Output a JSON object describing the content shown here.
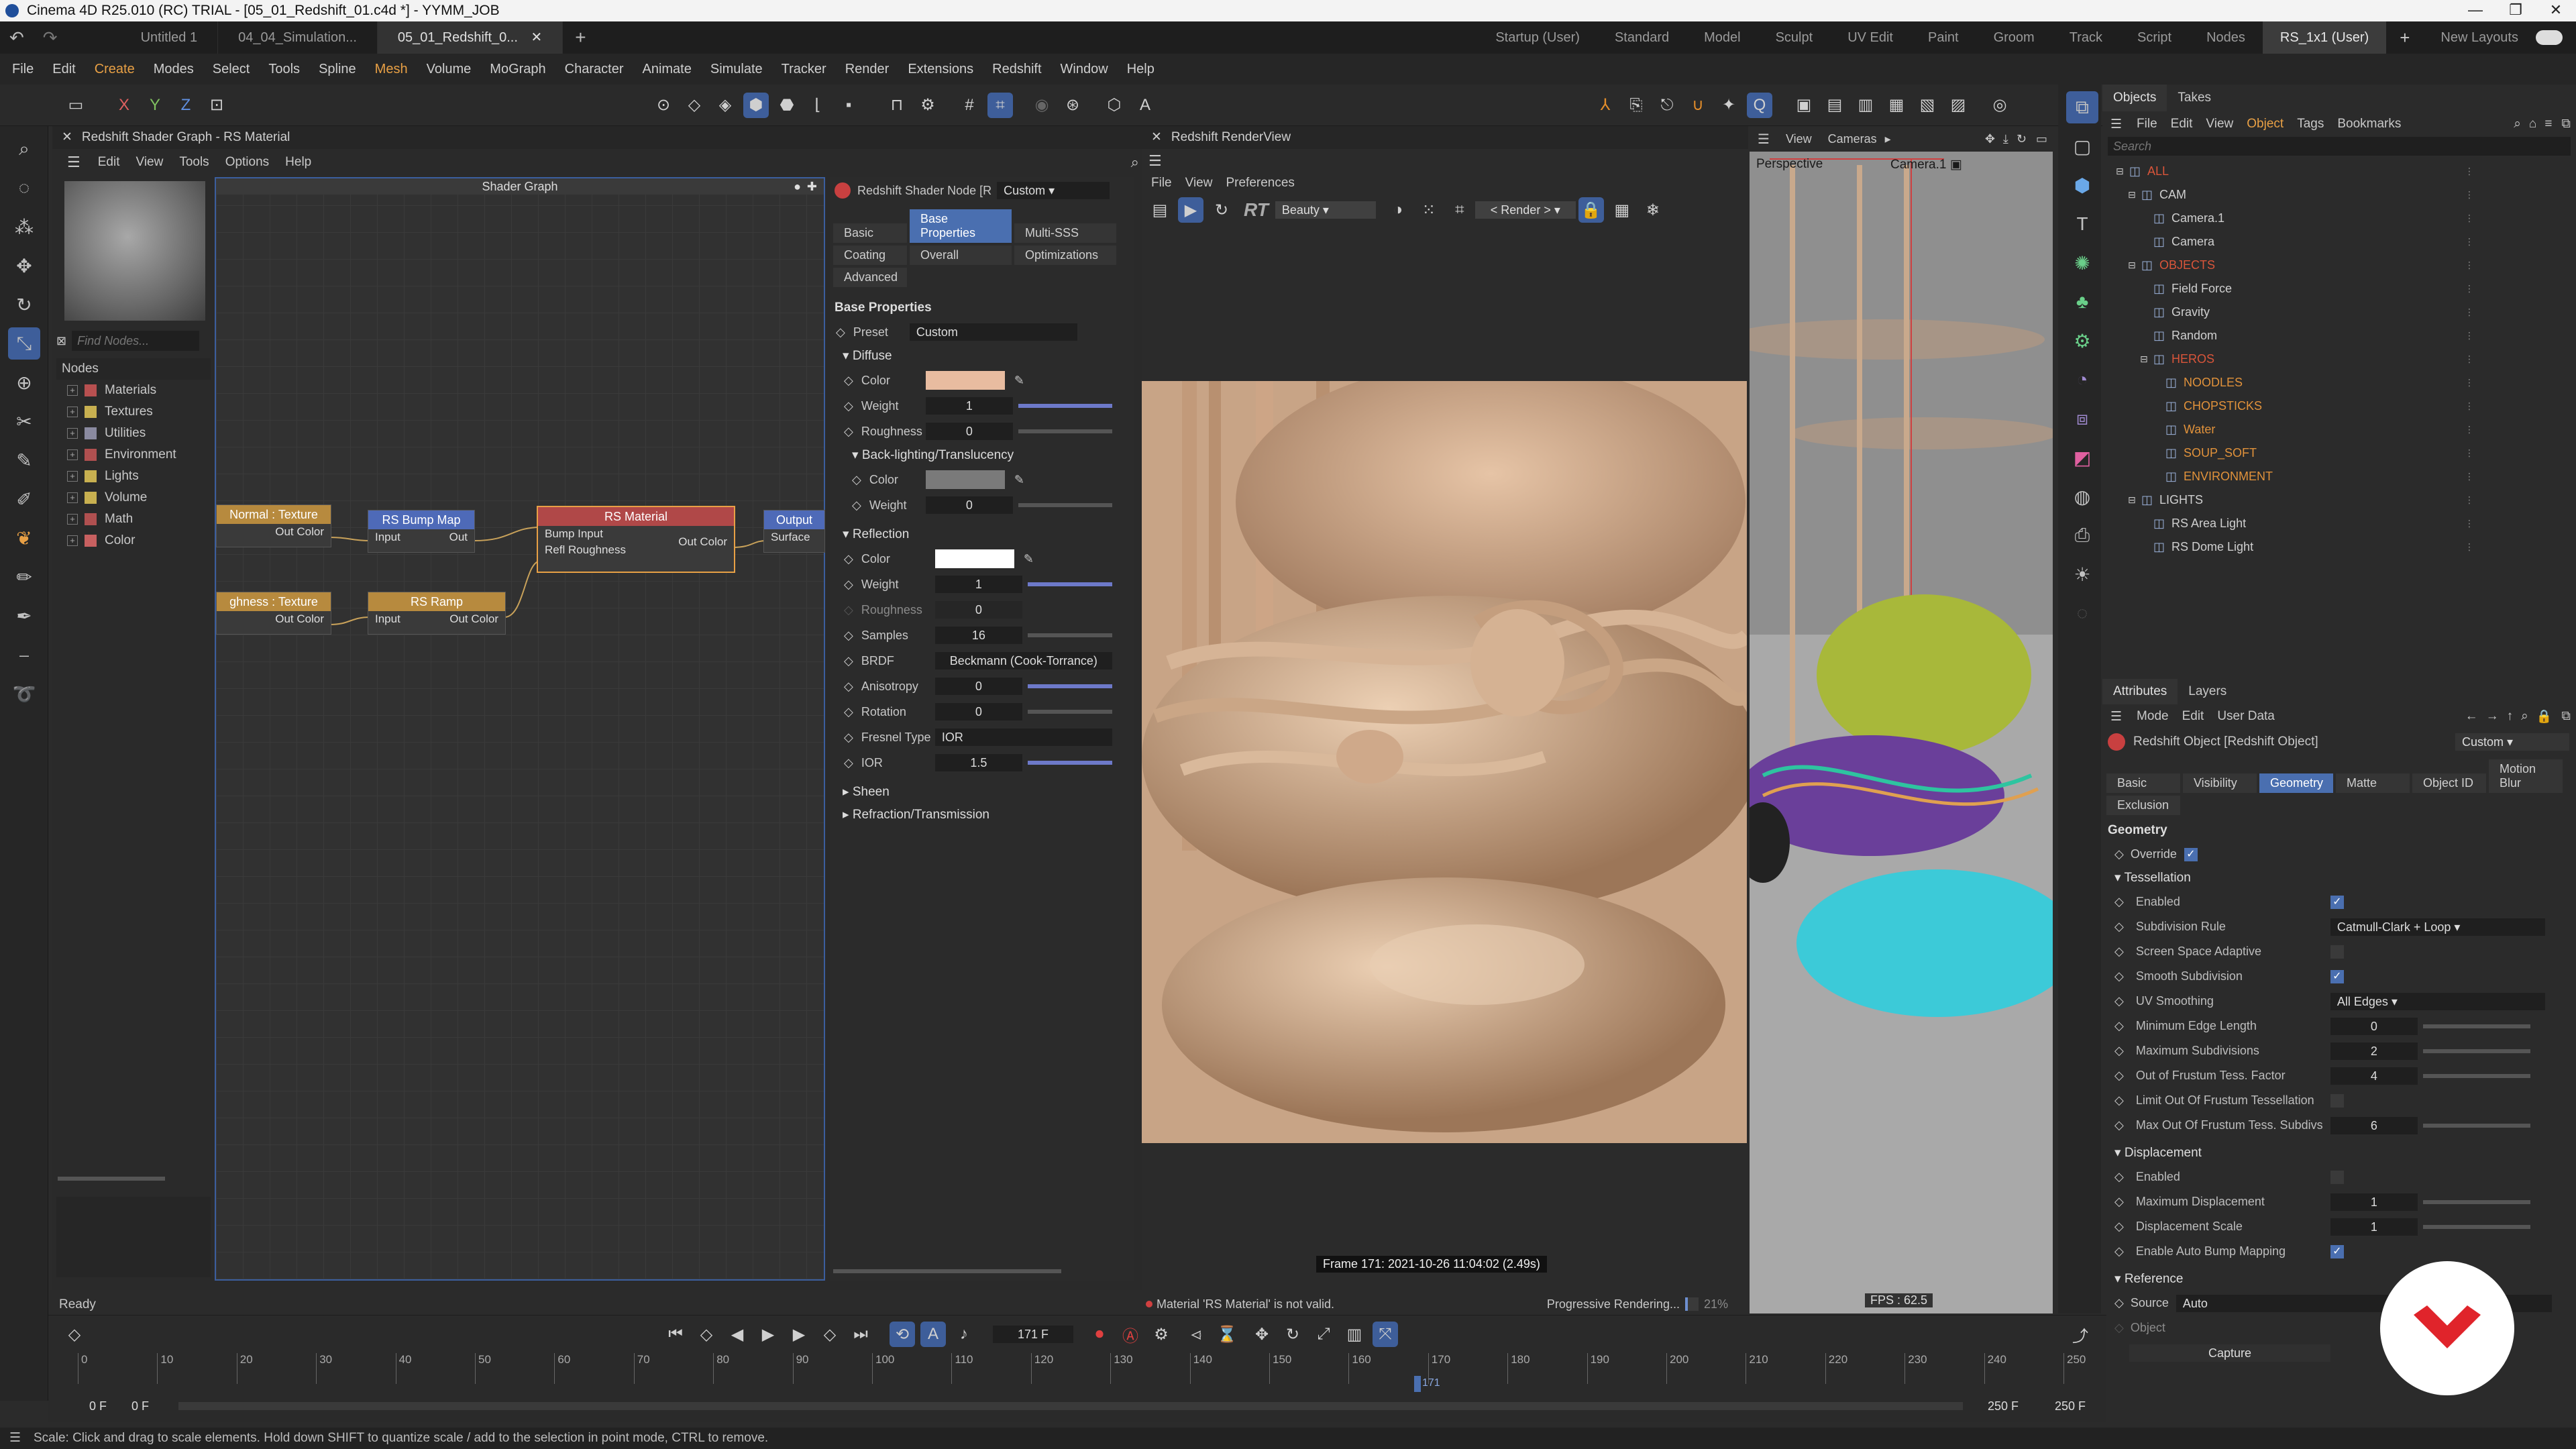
{
  "titlebar": {
    "title": "Cinema 4D R25.010 (RC) TRIAL - [05_01_Redshift_01.c4d *] - YYMM_JOB"
  },
  "doc_tabs": [
    "Untitled 1",
    "04_04_Simulation...",
    "05_01_Redshift_0..."
  ],
  "layout_tabs": [
    "Startup (User)",
    "Standard",
    "Model",
    "Sculpt",
    "UV Edit",
    "Paint",
    "Groom",
    "Track",
    "Script",
    "Nodes",
    "RS_1x1 (User)"
  ],
  "new_layouts": "New Layouts",
  "menus": [
    "File",
    "Edit",
    "Create",
    "Modes",
    "Select",
    "Tools",
    "Spline",
    "Mesh",
    "Volume",
    "MoGraph",
    "Character",
    "Animate",
    "Simulate",
    "Tracker",
    "Render",
    "Extensions",
    "Redshift",
    "Window",
    "Help"
  ],
  "toolbar_axes": [
    "X",
    "Y",
    "Z"
  ],
  "shader": {
    "title": "Redshift Shader Graph - RS Material",
    "menus": [
      "Edit",
      "View",
      "Tools",
      "Options",
      "Help"
    ],
    "find_placeholder": "Find Nodes...",
    "nodes_header": "Nodes",
    "categories": [
      {
        "label": "Materials",
        "color": "#b85050"
      },
      {
        "label": "Textures",
        "color": "#c8b050"
      },
      {
        "label": "Utilities",
        "color": "#8a8aa0"
      },
      {
        "label": "Environment",
        "color": "#b05050"
      },
      {
        "label": "Lights",
        "color": "#c8b050"
      },
      {
        "label": "Volume",
        "color": "#c8b050"
      },
      {
        "label": "Math",
        "color": "#b05050"
      },
      {
        "label": "Color",
        "color": "#c86060"
      }
    ],
    "graph_title": "Shader Graph",
    "status": "Ready",
    "nodes": {
      "normal_texture": {
        "title": "Normal : Texture",
        "out": "Out Color"
      },
      "bump_map": {
        "title": "RS Bump Map",
        "in": "Input",
        "out": "Out"
      },
      "rs_material": {
        "title": "RS Material",
        "in1": "Bump Input",
        "in2": "Refl Roughness",
        "out": "Out Color"
      },
      "output": {
        "title": "Output",
        "in": "Surface"
      },
      "roughness_texture": {
        "title": "ghness : Texture",
        "out": "Out Color"
      },
      "rs_ramp": {
        "title": "RS Ramp",
        "in": "Input",
        "out": "Out Color"
      }
    }
  },
  "props": {
    "node_title": "Redshift Shader Node [R",
    "preset_dropdown": "Custom",
    "tabs": [
      "Basic",
      "Base Properties",
      "Multi-SSS",
      "Coating",
      "Overall",
      "Optimizations",
      "Advanced"
    ],
    "section": "Base Properties",
    "preset_label": "Preset",
    "preset_value": "Custom",
    "diffuse": {
      "title": "Diffuse",
      "color_label": "Color",
      "color": "#e8bca0",
      "weight_label": "Weight",
      "weight": "1",
      "weight_level": 1.0,
      "roughness_label": "Roughness",
      "roughness": "0",
      "roughness_level": 0.0
    },
    "backlight": {
      "title": "Back-lighting/Translucency",
      "color_label": "Color",
      "color": "#7a7a7a",
      "weight_label": "Weight",
      "weight": "0"
    },
    "reflection": {
      "title": "Reflection",
      "color_label": "Color",
      "color": "#ffffff",
      "weight_label": "Weight",
      "weight": "1",
      "weight_level": 1.0,
      "roughness_label": "Roughness",
      "roughness": "0",
      "samples_label": "Samples",
      "samples": "16",
      "brdf_label": "BRDF",
      "brdf": "Beckmann (Cook-Torrance)",
      "aniso_label": "Anisotropy",
      "aniso": "0",
      "aniso_level": 1.0,
      "rotation_label": "Rotation",
      "rotation": "0",
      "fresnel_label": "Fresnel Type",
      "fresnel": "IOR",
      "ior_label": "IOR",
      "ior": "1.5",
      "ior_level": 1.0
    },
    "sheen": "Sheen",
    "refraction": "Refraction/Transmission"
  },
  "renderview": {
    "title": "Redshift RenderView",
    "menus": [
      "File",
      "View",
      "Preferences"
    ],
    "aov": "Beauty",
    "render_btn": "< Render >",
    "rt_label": "RT",
    "frame_info": "Frame  171:  2021-10-26  11:04:02  (2.49s)",
    "error": "Material 'RS Material' is not valid.",
    "progress_label": "Progressive Rendering...",
    "progress_pct": "21%",
    "progress_level": 0.21
  },
  "viewport": {
    "menus": [
      "View",
      "Cameras"
    ],
    "mode": "Perspective",
    "camera": "Camera.1",
    "fps": "FPS : 62.5"
  },
  "objects": {
    "tabs": [
      "Objects",
      "Takes"
    ],
    "menus": [
      "File",
      "Edit",
      "View",
      "Object",
      "Tags",
      "Bookmarks"
    ],
    "search_placeholder": "Search",
    "items": [
      {
        "name": "ALL",
        "depth": 0,
        "style": "red"
      },
      {
        "name": "CAM",
        "depth": 1,
        "style": ""
      },
      {
        "name": "Camera.1",
        "depth": 2,
        "style": ""
      },
      {
        "name": "Camera",
        "depth": 2,
        "style": ""
      },
      {
        "name": "OBJECTS",
        "depth": 1,
        "style": "red"
      },
      {
        "name": "Field Force",
        "depth": 2,
        "style": ""
      },
      {
        "name": "Gravity",
        "depth": 2,
        "style": ""
      },
      {
        "name": "Random",
        "depth": 2,
        "style": ""
      },
      {
        "name": "HEROS",
        "depth": 2,
        "style": "red"
      },
      {
        "name": "NOODLES",
        "depth": 3,
        "style": "orange"
      },
      {
        "name": "CHOPSTICKS",
        "depth": 3,
        "style": "orange"
      },
      {
        "name": "Water",
        "depth": 3,
        "style": "orange"
      },
      {
        "name": "SOUP_SOFT",
        "depth": 3,
        "style": "orange"
      },
      {
        "name": "ENVIRONMENT",
        "depth": 3,
        "style": "orange"
      },
      {
        "name": "LIGHTS",
        "depth": 1,
        "style": ""
      },
      {
        "name": "RS Area Light",
        "depth": 2,
        "style": ""
      },
      {
        "name": "RS Dome Light",
        "depth": 2,
        "style": ""
      }
    ]
  },
  "attributes": {
    "tabs": [
      "Attributes",
      "Layers"
    ],
    "menus": [
      "Mode",
      "Edit",
      "User Data"
    ],
    "object_title": "Redshift Object [Redshift Object]",
    "custom_dropdown": "Custom",
    "sub_tabs": [
      "Basic",
      "Visibility",
      "Geometry",
      "Matte",
      "Object ID",
      "Motion Blur",
      "Exclusion"
    ],
    "geometry_title": "Geometry",
    "override_label": "Override",
    "tessellation": "Tessellation",
    "rows": [
      {
        "label": "Enabled",
        "kind": "check",
        "value": "on"
      },
      {
        "label": "Subdivision Rule",
        "kind": "dropdown",
        "value": "Catmull-Clark + Loop"
      },
      {
        "label": "Screen Space Adaptive",
        "kind": "check",
        "value": "off"
      },
      {
        "label": "Smooth Subdivision",
        "kind": "check",
        "value": "on"
      },
      {
        "label": "UV Smoothing",
        "kind": "dropdown",
        "value": "All Edges"
      },
      {
        "label": "Minimum Edge Length",
        "kind": "num",
        "value": "0"
      },
      {
        "label": "Maximum Subdivisions",
        "kind": "num",
        "value": "2"
      },
      {
        "label": "Out of Frustum Tess. Factor",
        "kind": "num",
        "value": "4"
      },
      {
        "label": "Limit Out Of Frustum Tessellation",
        "kind": "check",
        "value": "off"
      },
      {
        "label": "Max Out Of Frustum Tess. Subdivs",
        "kind": "num",
        "value": "6"
      }
    ],
    "displacement": "Displacement",
    "disp_rows": [
      {
        "label": "Enabled",
        "kind": "check",
        "value": "off"
      },
      {
        "label": "Maximum Displacement",
        "kind": "num",
        "value": "1"
      },
      {
        "label": "Displacement Scale",
        "kind": "num",
        "value": "1"
      },
      {
        "label": "Enable Auto Bump Mapping",
        "kind": "check",
        "value": "on"
      }
    ],
    "reference": "Reference",
    "source_label": "Source",
    "source_value": "Auto",
    "object_label": "Object",
    "capture_btn": "Capture"
  },
  "timeline": {
    "ticks": [
      "0",
      "10",
      "20",
      "30",
      "40",
      "50",
      "60",
      "70",
      "80",
      "90",
      "100",
      "110",
      "120",
      "130",
      "140",
      "150",
      "160",
      "170",
      "180",
      "190",
      "200",
      "210",
      "220",
      "230",
      "240",
      "250"
    ],
    "current_frame": "171 F",
    "start": "0 F",
    "start2": "0 F",
    "end": "250 F",
    "end2": "250 F",
    "marker": "171"
  },
  "statusbar": "Scale: Click and drag to scale elements. Hold down SHIFT to quantize scale / add to the selection in point mode, CTRL to remove."
}
